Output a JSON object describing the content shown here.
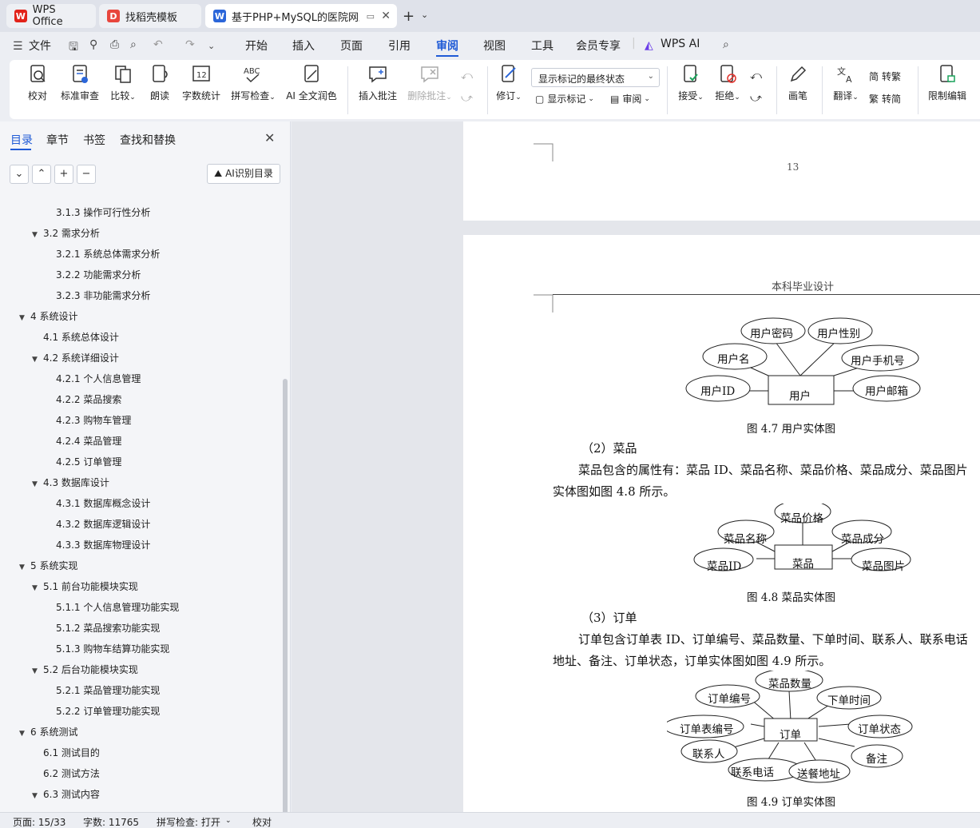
{
  "tabs": [
    {
      "label": "WPS Office",
      "icon": "wps-logo-icon"
    },
    {
      "label": "找稻壳模板",
      "icon": "docer-icon"
    },
    {
      "label": "基于PHP+MySQL的医院网上",
      "icon": "word-doc-icon"
    }
  ],
  "menu": {
    "file": "文件",
    "items": [
      "开始",
      "插入",
      "页面",
      "引用",
      "审阅",
      "视图",
      "工具",
      "会员专享"
    ],
    "active": "审阅",
    "wps_ai": "WPS AI"
  },
  "ribbon": {
    "proofread": "校对",
    "standard_review": "标准审查",
    "compare": "比较",
    "read_aloud": "朗读",
    "word_count": "字数统计",
    "spell_check": "拼写检查",
    "ai_polish": "AI 全文润色",
    "insert_comment": "插入批注",
    "delete_comment": "删除批注",
    "revise": "修订",
    "display_status": "显示标记的最终状态",
    "show_markup": "显示标记",
    "review_pane": "审阅",
    "accept": "接受",
    "reject": "拒绝",
    "pen": "画笔",
    "translate": "翻译",
    "to_traditional": "转繁",
    "to_simplified": "转简",
    "restrict_edit": "限制编辑"
  },
  "panel": {
    "tabs": [
      "目录",
      "章节",
      "书签",
      "查找和替换"
    ],
    "ai_toc": "AI识别目录",
    "toc": [
      {
        "text": "3.1.3  操作可行性分析",
        "level": 3,
        "tri": false
      },
      {
        "text": "3.2  需求分析",
        "level": 2,
        "tri": true
      },
      {
        "text": "3.2.1  系统总体需求分析",
        "level": 3,
        "tri": false
      },
      {
        "text": "3.2.2  功能需求分析",
        "level": 3,
        "tri": false
      },
      {
        "text": "3.2.3  非功能需求分析",
        "level": 3,
        "tri": false
      },
      {
        "text": "4  系统设计",
        "level": 1,
        "tri": true
      },
      {
        "text": "4.1  系统总体设计",
        "level": 2,
        "tri": false
      },
      {
        "text": "4.2  系统详细设计",
        "level": 2,
        "tri": true
      },
      {
        "text": "4.2.1  个人信息管理",
        "level": 3,
        "tri": false
      },
      {
        "text": "4.2.2  菜品搜索",
        "level": 3,
        "tri": false
      },
      {
        "text": "4.2.3  购物车管理",
        "level": 3,
        "tri": false
      },
      {
        "text": "4.2.4  菜品管理",
        "level": 3,
        "tri": false
      },
      {
        "text": "4.2.5  订单管理",
        "level": 3,
        "tri": false
      },
      {
        "text": "4.3  数据库设计",
        "level": 2,
        "tri": true
      },
      {
        "text": "4.3.1  数据库概念设计",
        "level": 3,
        "tri": false
      },
      {
        "text": "4.3.2  数据库逻辑设计",
        "level": 3,
        "tri": false
      },
      {
        "text": "4.3.3  数据库物理设计",
        "level": 3,
        "tri": false
      },
      {
        "text": "5  系统实现",
        "level": 1,
        "tri": true
      },
      {
        "text": "5.1  前台功能模块实现",
        "level": 2,
        "tri": true
      },
      {
        "text": "5.1.1  个人信息管理功能实现",
        "level": 3,
        "tri": false
      },
      {
        "text": "5.1.2  菜品搜索功能实现",
        "level": 3,
        "tri": false
      },
      {
        "text": "5.1.3  购物车结算功能实现",
        "level": 3,
        "tri": false
      },
      {
        "text": "5.2  后台功能模块实现",
        "level": 2,
        "tri": true
      },
      {
        "text": "5.2.1  菜品管理功能实现",
        "level": 3,
        "tri": false
      },
      {
        "text": "5.2.2  订单管理功能实现",
        "level": 3,
        "tri": false
      },
      {
        "text": "6  系统测试",
        "level": 1,
        "tri": true
      },
      {
        "text": "6.1  测试目的",
        "level": 2,
        "tri": false
      },
      {
        "text": "6.2  测试方法",
        "level": 2,
        "tri": false
      },
      {
        "text": "6.3  测试内容",
        "level": 2,
        "tri": true
      }
    ]
  },
  "document": {
    "prev_page_number": "13",
    "header": "本科毕业设计",
    "user_er": {
      "entity": "用户",
      "attrs": [
        "用户密码",
        "用户性别",
        "用户名",
        "用户手机号",
        "用户ID",
        "用户邮箱"
      ],
      "caption": "图 4.7  用户实体图"
    },
    "dish_heading": "（2）菜品",
    "dish_para_1": "菜品包含的属性有：菜品 ID、菜品名称、菜品价格、菜品成分、菜品图片",
    "dish_para_2": "实体图如图 4.8 所示。",
    "dish_er": {
      "entity": "菜品",
      "attrs": [
        "菜品价格",
        "菜品名称",
        "菜品成分",
        "菜品ID",
        "菜品图片"
      ],
      "caption": "图 4.8  菜品实体图"
    },
    "order_heading": "（3）订单",
    "order_para_1": "订单包含订单表 ID、订单编号、菜品数量、下单时间、联系人、联系电话",
    "order_para_2": "地址、备注、订单状态，订单实体图如图 4.9 所示。",
    "order_er": {
      "entity": "订单",
      "attrs": [
        "菜品数量",
        "订单编号",
        "下单时间",
        "订单表编号",
        "订单状态",
        "联系人",
        "备注",
        "联系电话",
        "送餐地址"
      ],
      "caption": "图 4.9  订单实体图"
    }
  },
  "status": {
    "page": "页面: 15/33",
    "words": "字数: 11765",
    "spell": "拼写检查: 打开",
    "proof": "校对"
  }
}
